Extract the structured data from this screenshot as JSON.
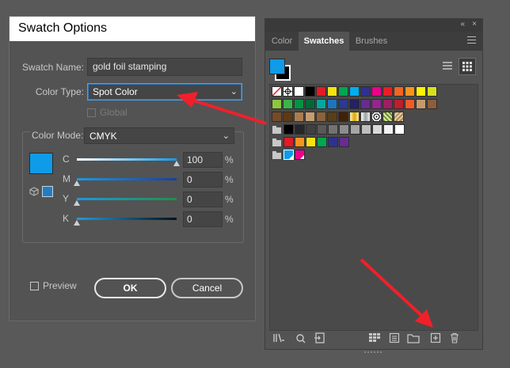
{
  "dialog": {
    "title": "Swatch Options",
    "swatch_name_label": "Swatch Name:",
    "swatch_name_value": "gold foil stamping",
    "color_type_label": "Color Type:",
    "color_type_value": "Spot Color",
    "global_label": "Global",
    "color_mode_label": "Color Mode:",
    "color_mode_value": "CMYK",
    "preview_color": "#0e9be8",
    "channels": [
      {
        "label": "C",
        "value": "100",
        "fill": 1.0,
        "pct": "%",
        "gradient": "linear-gradient(to right,#ffffff,#0e9be8)"
      },
      {
        "label": "M",
        "value": "0",
        "fill": 0.0,
        "pct": "%",
        "gradient": "linear-gradient(to right,#1d9ae0,#1b3f9a)"
      },
      {
        "label": "Y",
        "value": "0",
        "fill": 0.0,
        "pct": "%",
        "gradient": "linear-gradient(to right,#1e99df,#1f8f48)"
      },
      {
        "label": "K",
        "value": "0",
        "fill": 0.0,
        "pct": "%",
        "gradient": "linear-gradient(to right,#1e9be0,#04111a)"
      }
    ],
    "preview_label": "Preview",
    "ok_label": "OK",
    "cancel_label": "Cancel"
  },
  "panel": {
    "tabs": [
      "Color",
      "Swatches",
      "Brushes"
    ],
    "active_tab": "Swatches",
    "fill_color": "#0e9be8",
    "rows": [
      [
        "none",
        "registration",
        "#ffffff",
        "#000000",
        "#e31b23",
        "#f5e211",
        "#00a651",
        "#00aeef",
        "#2e3192",
        "#ec008c",
        "#ed1c24",
        "#f26522",
        "#f7941d",
        "#fff200",
        "#d7df23"
      ],
      [
        "#8dc63f",
        "#39b54a",
        "#009444",
        "#006838",
        "#00a99d",
        "#1c75bc",
        "#2b3990",
        "#262262",
        "#662d91",
        "#92278f",
        "#9e1f63",
        "#be1e2d",
        "#f15a29",
        "#c49a6c",
        "#8b5e3c"
      ],
      [
        "#754c29",
        "#603913",
        "#a97c50",
        "#c69c6d",
        "#8b6239",
        "#593e1a",
        "#42210b",
        "gold-grad",
        "#c0c0c0-grad",
        "pattern-a",
        "pattern-b",
        "pattern-c"
      ],
      [
        "folder",
        "#000000",
        "#262626",
        "#404040",
        "#595959",
        "#737373",
        "#8c8c8c",
        "#a6a6a6",
        "#bfbfbf",
        "#d9d9d9",
        "#f2f2f2",
        "#ffffff"
      ],
      [
        "folder",
        "#e31b23",
        "#f7941d",
        "#f5e211",
        "#00a651",
        "#2e3192",
        "#662d91"
      ],
      [
        "folder",
        "#0e9be8-spot",
        "#ec008c-spot"
      ]
    ],
    "bottom_icons": [
      "library-icon",
      "kind-icon",
      "import-icon",
      "show-options-icon",
      "swatch-options-icon",
      "new-group-icon",
      "new-swatch-icon",
      "delete-icon"
    ]
  }
}
